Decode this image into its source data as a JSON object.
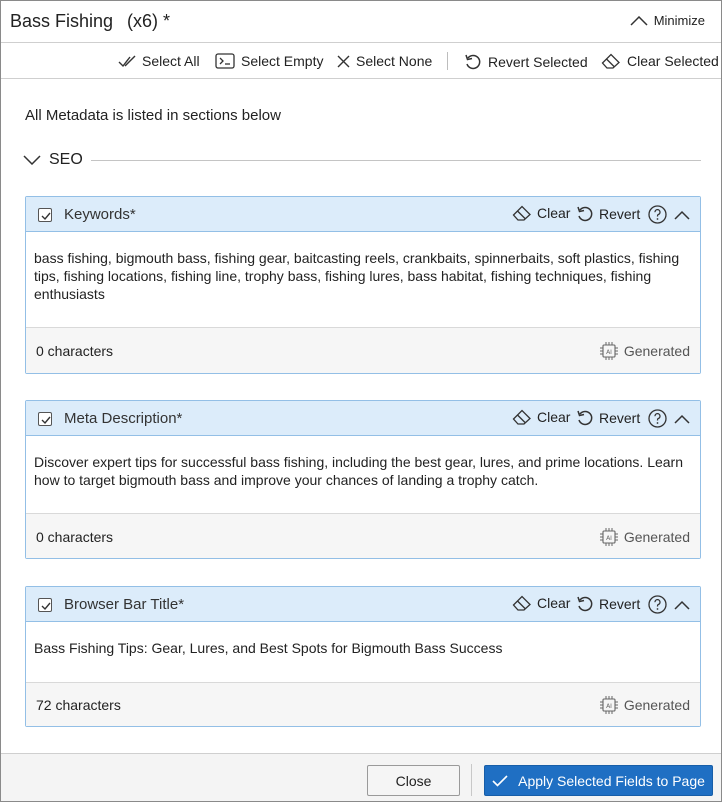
{
  "header": {
    "title": "Bass Fishing",
    "count": "(x6) *",
    "minimize_label": "Minimize"
  },
  "toolbar": {
    "select_all": "Select All",
    "select_empty": "Select Empty",
    "select_none": "Select None",
    "revert_selected": "Revert Selected",
    "clear_selected": "Clear Selected"
  },
  "intro_text": "All Metadata is listed in sections below",
  "section": {
    "label": "SEO"
  },
  "cards": [
    {
      "title": "Keywords*",
      "checked": true,
      "clear_label": "Clear",
      "revert_label": "Revert",
      "body": "bass fishing, bigmouth bass, fishing gear, baitcasting reels, crankbaits, spinnerbaits, soft plastics, fishing tips, fishing locations, fishing line, trophy bass, fishing lures, bass habitat, fishing techniques, fishing enthusiasts",
      "char_count": "0 characters",
      "generated_label": "Generated"
    },
    {
      "title": "Meta Description*",
      "checked": true,
      "clear_label": "Clear",
      "revert_label": "Revert",
      "body": "Discover expert tips for successful bass fishing, including the best gear, lures, and prime locations. Learn how to target bigmouth bass and improve your chances of landing a trophy catch.",
      "char_count": "0 characters",
      "generated_label": "Generated"
    },
    {
      "title": "Browser Bar Title*",
      "checked": true,
      "clear_label": "Clear",
      "revert_label": "Revert",
      "body": "Bass Fishing Tips: Gear, Lures, and Best Spots for Bigmouth Bass Success",
      "char_count": "72 characters",
      "generated_label": "Generated"
    }
  ],
  "footer": {
    "close_label": "Close",
    "apply_label": "Apply Selected Fields to Page"
  },
  "colors": {
    "card_header_bg": "#dcecfa",
    "card_border": "#93bfe6",
    "primary_button": "#1f6fc3"
  }
}
